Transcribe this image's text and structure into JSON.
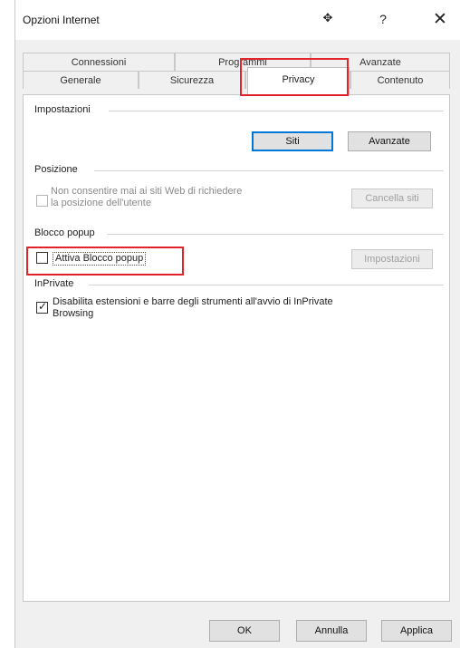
{
  "window": {
    "title": "Opzioni Internet",
    "pin_glyph": "✥",
    "help_glyph": "?",
    "close_glyph": "✕"
  },
  "tabs": {
    "top_row": [
      "Connessioni",
      "Programmi",
      "Avanzate"
    ],
    "bottom_row": [
      "Generale",
      "Sicurezza",
      "Contenuto"
    ],
    "active": "Privacy"
  },
  "settings": {
    "group_label": "Impostazioni",
    "sites_button": "Siti",
    "advanced_button": "Avanzate"
  },
  "location": {
    "group_label": "Posizione",
    "checkbox_label_line1": "Non consentire mai ai siti Web di richiedere",
    "checkbox_label_line2": "la posizione dell'utente",
    "checked": false,
    "clear_button": "Cancella siti"
  },
  "popup": {
    "group_label": "Blocco popup",
    "checkbox_label": "Attiva Blocco popup",
    "checked": false,
    "settings_button": "Impostazioni"
  },
  "inprivate": {
    "group_label": "InPrivate",
    "checkbox_label_line1": "Disabilita estensioni e barre degli strumenti all'avvio di InPrivate",
    "checkbox_label_line2": "Browsing",
    "checked": true
  },
  "footer": {
    "ok": "OK",
    "cancel": "Annulla",
    "apply": "Applica"
  },
  "colors": {
    "highlight": "#e0262b",
    "focus": "#0078d7"
  }
}
